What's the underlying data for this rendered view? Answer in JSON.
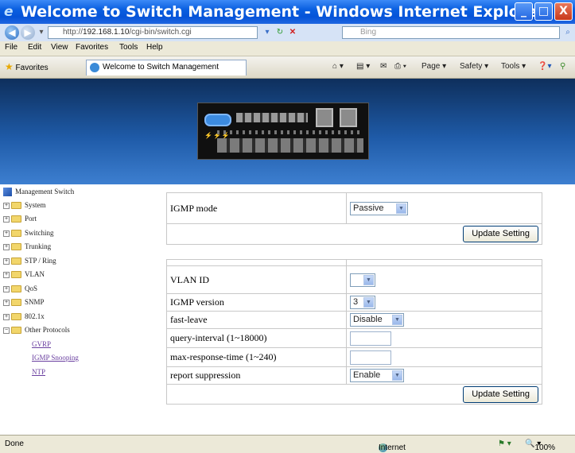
{
  "window": {
    "title": "Welcome to Switch Management - Windows Internet Explorer",
    "buttons": {
      "minimize": "_",
      "maximize": "□",
      "close": "X"
    }
  },
  "address_bar": {
    "url_prefix": "http://",
    "url_host": "192.168.1.10",
    "url_path": "/cgi-bin/switch.cgi",
    "search_placeholder": "Bing"
  },
  "menu": [
    "File",
    "Edit",
    "View",
    "Favorites",
    "Tools",
    "Help"
  ],
  "favorites_bar": {
    "favorites_label": "Favorites",
    "tab_title": "Welcome to Switch Management",
    "commands": [
      "Page ▾",
      "Safety ▾",
      "Tools ▾"
    ]
  },
  "sidebar": {
    "root": "Management Switch",
    "items": [
      {
        "label": "System",
        "expand": "+"
      },
      {
        "label": "Port",
        "expand": "+"
      },
      {
        "label": "Switching",
        "expand": "+"
      },
      {
        "label": "Trunking",
        "expand": "+"
      },
      {
        "label": "STP / Ring",
        "expand": "+"
      },
      {
        "label": "VLAN",
        "expand": "+"
      },
      {
        "label": "QoS",
        "expand": "+"
      },
      {
        "label": "SNMP",
        "expand": "+"
      },
      {
        "label": "802.1x",
        "expand": "+"
      },
      {
        "label": "Other Protocols",
        "expand": "−"
      }
    ],
    "sub_items": [
      "GVRP",
      "IGMP Snooping",
      "NTP"
    ]
  },
  "igmp_mode_form": {
    "mode_label": "IGMP mode",
    "mode_value": "Passive",
    "update_button": "Update Setting"
  },
  "vlan_form": {
    "vlan_id_label": "VLAN ID",
    "vlan_id_value": "",
    "version_label": "IGMP version",
    "version_value": "3",
    "fast_leave_label": "fast-leave",
    "fast_leave_value": "Disable",
    "query_interval_label": "query-interval (1~18000)",
    "query_interval_value": "",
    "max_response_label": "max-response-time (1~240)",
    "max_response_value": "",
    "report_suppression_label": "report suppression",
    "report_suppression_value": "Enable",
    "update_button": "Update Setting"
  },
  "status_bar": {
    "status": "Done",
    "zone": "Internet",
    "zoom": "100%"
  }
}
